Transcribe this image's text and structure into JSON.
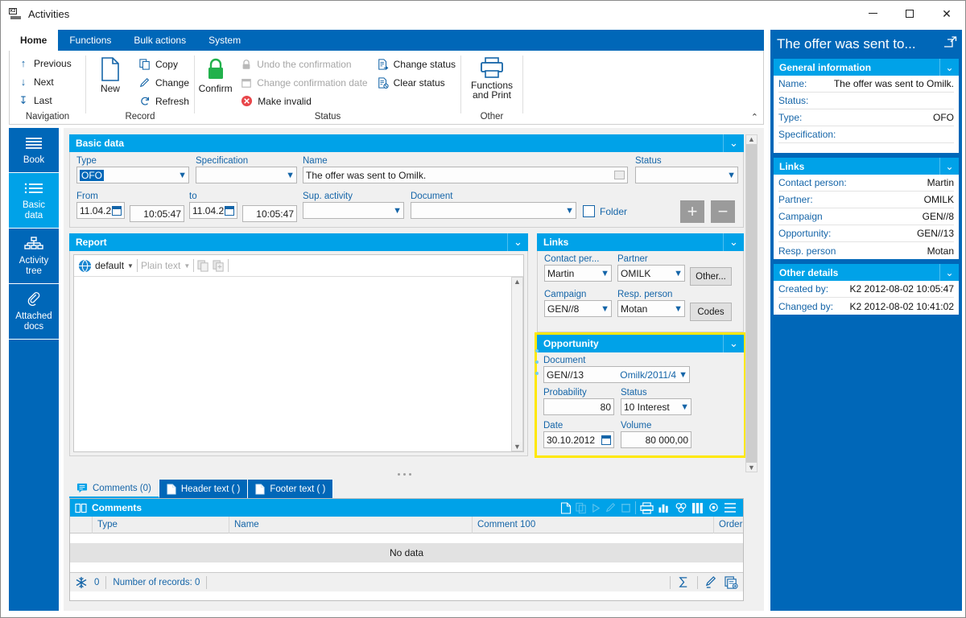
{
  "window": {
    "title": "Activities",
    "minimize": "—",
    "maximize": "☐",
    "close": "✕"
  },
  "ribbon": {
    "tabs": [
      {
        "label": "Home",
        "active": true
      },
      {
        "label": "Functions",
        "active": false
      },
      {
        "label": "Bulk actions",
        "active": false
      },
      {
        "label": "System",
        "active": false
      }
    ],
    "collapse_glyph": "⌃",
    "groups": [
      {
        "title": "Navigation",
        "items": [
          {
            "label": "Previous",
            "icon": "arrow-up-icon",
            "glyph": "↑",
            "disabled": false
          },
          {
            "label": "Next",
            "icon": "arrow-down-icon",
            "glyph": "↓",
            "disabled": false
          },
          {
            "label": "Last",
            "icon": "arrow-down-bar-icon",
            "glyph": "⤓",
            "disabled": false
          }
        ]
      },
      {
        "title": "Record",
        "big": {
          "label": "New",
          "icon": "new-document-icon"
        },
        "items": [
          {
            "label": "Copy",
            "icon": "copy-icon",
            "disabled": false
          },
          {
            "label": "Change",
            "icon": "pencil-icon",
            "disabled": false
          },
          {
            "label": "Refresh",
            "icon": "refresh-icon",
            "disabled": false
          }
        ]
      },
      {
        "title": "Status",
        "big": {
          "label": "Confirm",
          "icon": "padlock-green-icon"
        },
        "items": [
          {
            "label": "Undo the confirmation",
            "icon": "padlock-gray-icon",
            "disabled": true
          },
          {
            "label": "Change confirmation date",
            "icon": "calendar-gray-icon",
            "disabled": true
          },
          {
            "label": "Make invalid",
            "icon": "cancel-red-icon",
            "disabled": false
          },
          {
            "label": "Change status",
            "icon": "document-arrow-icon",
            "disabled": false
          },
          {
            "label": "Clear status",
            "icon": "document-clear-icon",
            "disabled": false
          }
        ]
      },
      {
        "title": "Other",
        "big": {
          "label": "Functions\nand Print",
          "label_line1": "Functions",
          "label_line2": "and Print",
          "icon": "printer-icon"
        }
      }
    ]
  },
  "sidebar_nav": {
    "items": [
      {
        "label": "Book",
        "icon": "list-lines-icon",
        "active": false
      },
      {
        "label_line1": "Basic",
        "label_line2": "data",
        "icon": "bulleted-list-icon",
        "active": true
      },
      {
        "label_line1": "Activity",
        "label_line2": "tree",
        "icon": "org-tree-icon",
        "active": false
      },
      {
        "label_line1": "Attached",
        "label_line2": "docs",
        "icon": "paperclip-icon",
        "active": false
      }
    ]
  },
  "basic_data": {
    "title": "Basic data",
    "type": {
      "label": "Type",
      "value": "OFO"
    },
    "specification": {
      "label": "Specification",
      "value": ""
    },
    "name": {
      "label": "Name",
      "value": "The offer was sent to Omilk."
    },
    "status": {
      "label": "Status",
      "value": ""
    },
    "from": {
      "label": "From",
      "date": "11.04.2",
      "time": "10:05:47"
    },
    "to": {
      "label": "to",
      "date": "11.04.2",
      "time": "10:05:47"
    },
    "sup_activity": {
      "label": "Sup. activity",
      "value": ""
    },
    "document": {
      "label": "Document",
      "value": ""
    },
    "folder": {
      "label": "Folder",
      "checked": false
    },
    "add_button": "+",
    "remove_button": "−"
  },
  "report": {
    "title": "Report",
    "toolbar": {
      "globe_icon": "globe-icon",
      "default_label": "default",
      "plain_text_label": "Plain text",
      "copy_icon": "copy-icon",
      "copy_add_icon": "copy-add-icon"
    },
    "body_text": ""
  },
  "links_panel": {
    "title": "Links",
    "contact_person": {
      "label": "Contact per...",
      "value": "Martin"
    },
    "partner": {
      "label": "Partner",
      "value": "OMILK"
    },
    "other_button": "Other...",
    "campaign": {
      "label": "Campaign",
      "value": "GEN//8"
    },
    "resp_person": {
      "label": "Resp. person",
      "value": "Motan"
    },
    "codes_button": "Codes"
  },
  "opportunity_panel": {
    "title": "Opportunity",
    "highlight_color": "#ffe800",
    "document": {
      "label": "Document",
      "value": "GEN//13",
      "value2": "Omilk/2011/4"
    },
    "probability": {
      "label": "Probability",
      "value": "80"
    },
    "status": {
      "label": "Status",
      "value": "10 Interest"
    },
    "date": {
      "label": "Date",
      "value": "30.10.2012"
    },
    "volume": {
      "label": "Volume",
      "value": "80 000,00"
    }
  },
  "bottom_tabs": [
    {
      "label": "Comments (0)",
      "icon": "comment-icon",
      "active": true
    },
    {
      "label": "Header text ( )",
      "icon": "document-icon",
      "active": false
    },
    {
      "label": "Footer text ( )",
      "icon": "document-icon",
      "active": false
    }
  ],
  "comments_grid": {
    "title": "Comments",
    "title_icon": "book-icon",
    "toolbar_icons": [
      "new-icon",
      "copy-icon",
      "run-icon",
      "edit-icon",
      "delete-icon",
      "print-icon",
      "chart-icon",
      "pivot-icon",
      "columns-icon",
      "settings-icon",
      "menu-icon"
    ],
    "columns": [
      "Type",
      "Name",
      "Comment 100",
      "Order"
    ],
    "rows": [],
    "no_data_text": "No data",
    "footer": {
      "filter_icon": "snowflake-icon",
      "filter_count": "0",
      "records_label": "Number of records: 0",
      "sum_icon": "sigma-icon",
      "edit_icon": "pencil-icon",
      "new_record_icon": "new-record-icon"
    }
  },
  "right_sidebar": {
    "title": "The offer was sent to...",
    "expand_icon": "open-external-icon",
    "general_information": {
      "title": "General information",
      "rows": [
        {
          "key": "Name:",
          "value": "The offer was sent to Omilk."
        },
        {
          "key": "Status:",
          "value": ""
        },
        {
          "key": "Type:",
          "value": "OFO"
        },
        {
          "key": "Specification:",
          "value": ""
        }
      ]
    },
    "links": {
      "title": "Links",
      "rows": [
        {
          "key": "Contact person:",
          "value": "Martin"
        },
        {
          "key": "Partner:",
          "value": "OMILK"
        },
        {
          "key": "Campaign",
          "value": "GEN//8"
        },
        {
          "key": "Opportunity:",
          "value": "GEN//13"
        },
        {
          "key": "Resp. person",
          "value": "Motan"
        }
      ]
    },
    "other_details": {
      "title": "Other details",
      "rows": [
        {
          "key": "Created by:",
          "value": "K2 2012-08-02 10:05:47"
        },
        {
          "key": "Changed by:",
          "value": "K2 2012-08-02 10:41:02"
        }
      ]
    }
  }
}
